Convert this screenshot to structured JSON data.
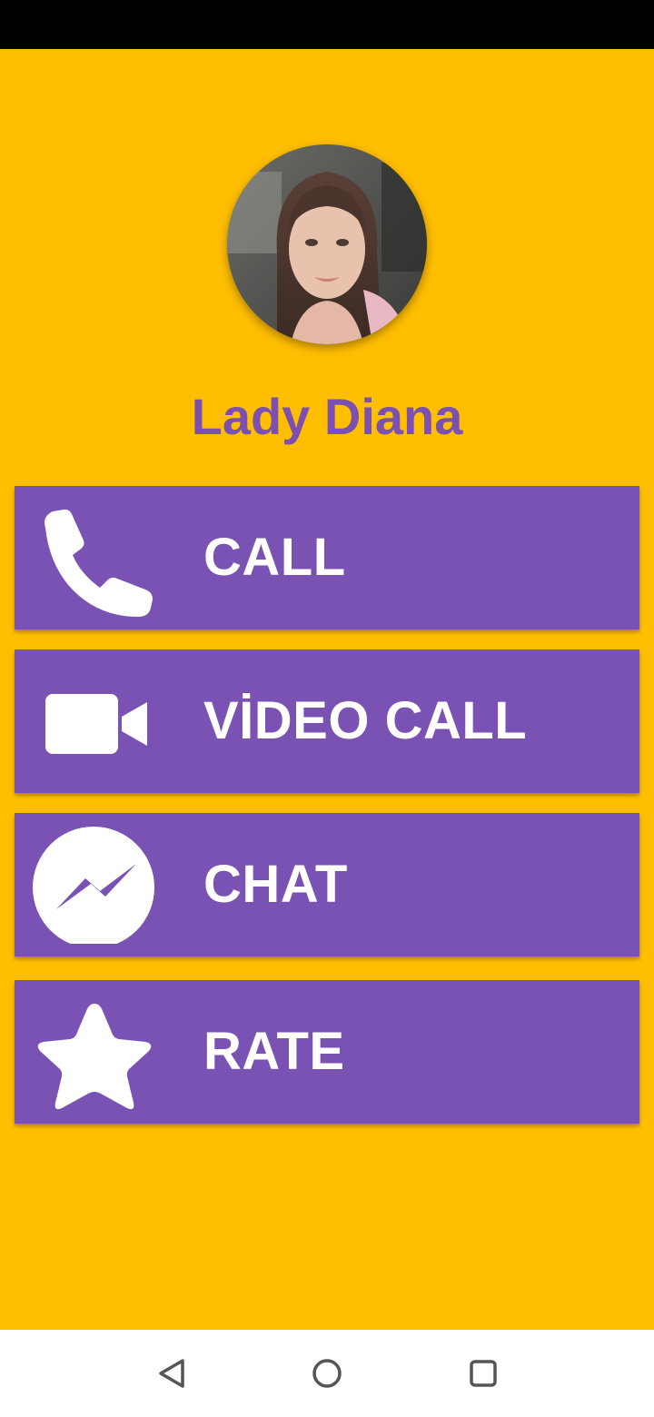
{
  "profile": {
    "name": "Lady Diana",
    "avatar_alt": "profile photo"
  },
  "buttons": [
    {
      "label": "CALL",
      "icon": "phone-icon"
    },
    {
      "label": "VİDEO CALL",
      "icon": "video-camera-icon"
    },
    {
      "label": "CHAT",
      "icon": "messenger-icon"
    },
    {
      "label": "RATE",
      "icon": "star-icon"
    }
  ],
  "nav": {
    "back": "back-icon",
    "home": "home-icon",
    "recents": "recents-icon"
  },
  "colors": {
    "background": "#FFBE00",
    "button": "#7A52B3",
    "name_text": "#7B50B0",
    "status_bar": "#000000"
  }
}
